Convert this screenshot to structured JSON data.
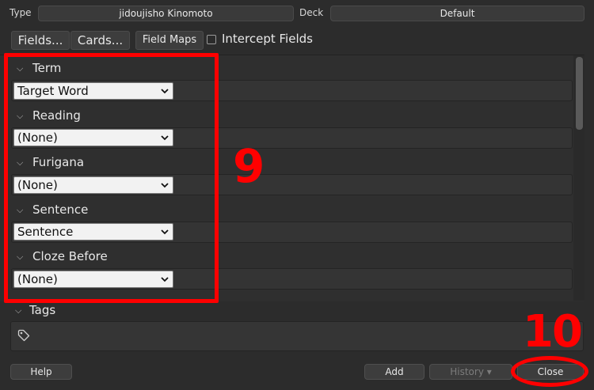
{
  "top": {
    "type_label": "Type",
    "type_value": "jidoujisho Kinomoto",
    "deck_label": "Deck",
    "deck_value": "Default"
  },
  "toolbar": {
    "fields_button": "Fields...",
    "cards_button": "Cards...",
    "field_maps_button": "Field Maps",
    "intercept_label": "Intercept Fields"
  },
  "fields": [
    {
      "label": "Term",
      "mapping": "Target Word"
    },
    {
      "label": "Reading",
      "mapping": "(None)"
    },
    {
      "label": "Furigana",
      "mapping": "(None)"
    },
    {
      "label": "Sentence",
      "mapping": "Sentence"
    },
    {
      "label": "Cloze Before",
      "mapping": "(None)"
    }
  ],
  "tags": {
    "label": "Tags"
  },
  "bottom": {
    "help": "Help",
    "add": "Add",
    "history": "History ▾",
    "close": "Close"
  },
  "annotations": {
    "box_number": "9",
    "close_number": "10",
    "color": "#ff0000"
  }
}
